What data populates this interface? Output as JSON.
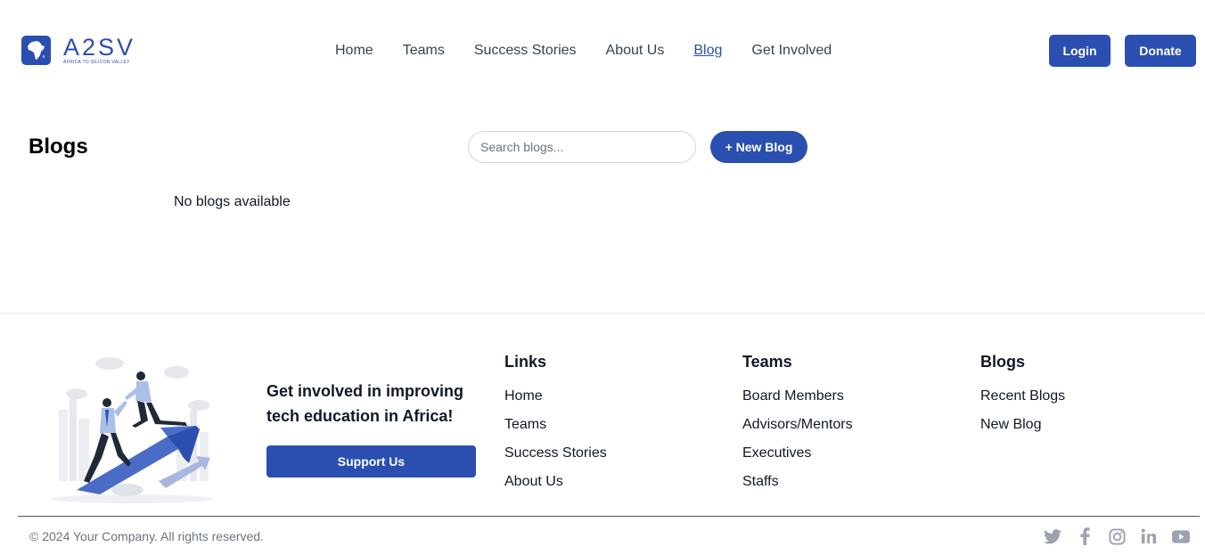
{
  "brand": {
    "name": "A2SV",
    "tagline": "AFRICA TO SILICON VALLEY",
    "color": "#2a4fb0"
  },
  "nav": {
    "items": [
      {
        "label": "Home"
      },
      {
        "label": "Teams"
      },
      {
        "label": "Success Stories"
      },
      {
        "label": "About Us"
      },
      {
        "label": "Blog",
        "active": true
      },
      {
        "label": "Get Involved"
      }
    ],
    "login_label": "Login",
    "donate_label": "Donate"
  },
  "blogs": {
    "title": "Blogs",
    "search_placeholder": "Search blogs...",
    "new_blog_label": "+ New Blog",
    "empty_message": "No blogs available"
  },
  "footer": {
    "cta_text": "Get involved in improving tech education in Africa!",
    "support_label": "Support Us",
    "columns": [
      {
        "title": "Links",
        "items": [
          "Home",
          "Teams",
          "Success Stories",
          "About Us"
        ]
      },
      {
        "title": "Teams",
        "items": [
          "Board Members",
          "Advisors/Mentors",
          "Executives",
          "Staffs"
        ]
      },
      {
        "title": "Blogs",
        "items": [
          "Recent Blogs",
          "New Blog"
        ]
      }
    ],
    "copyright": "© 2024 Your Company. All rights reserved.",
    "socials": [
      "twitter-icon",
      "facebook-icon",
      "instagram-icon",
      "linkedin-icon",
      "youtube-icon"
    ]
  },
  "colors": {
    "primary": "#2a4fb0",
    "muted_text": "#6b7280",
    "social_icon": "#9ca3af"
  }
}
